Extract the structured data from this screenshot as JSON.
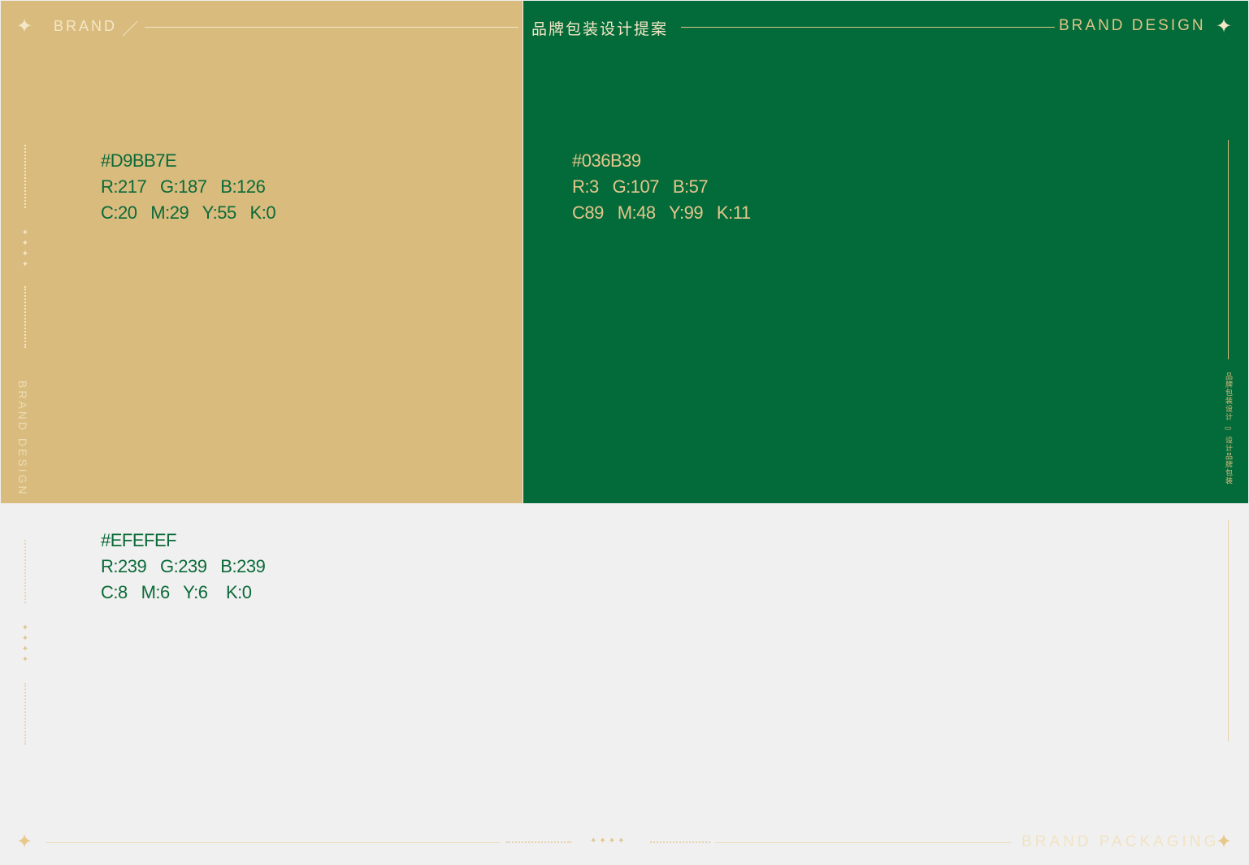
{
  "header": {
    "brand": "BRAND",
    "slash": "／",
    "title": "品牌包装设计提案",
    "brand_design": "BRAND DESIGN"
  },
  "swatches": [
    {
      "hex": "#D9BB7E",
      "rgb": "R:217   G:187   B:126",
      "cmyk": "C:20   M:29   Y:55   K:0"
    },
    {
      "hex": "#036B39",
      "rgb": "R:3   G:107   B:57",
      "cmyk": "C89   M:48   Y:99   K:11"
    },
    {
      "hex": "#EFEFEF",
      "rgb": "R:239   G:239   B:239",
      "cmyk": "C:8   M:6   Y:6    K:0"
    }
  ],
  "side": {
    "left_vertical": "BRAND DESIGN",
    "right_vertical": "品牌包装设计 ▭ 设计品牌包装"
  },
  "footer": {
    "brand_packaging": "BRAND PACKAGING"
  },
  "icons": {
    "star": "four-point-star-icon",
    "mini_stars": "mini-star-cluster-icon"
  },
  "colors": {
    "gold": "#D9BB7E",
    "green": "#036B39",
    "gray": "#EFEFEF"
  }
}
